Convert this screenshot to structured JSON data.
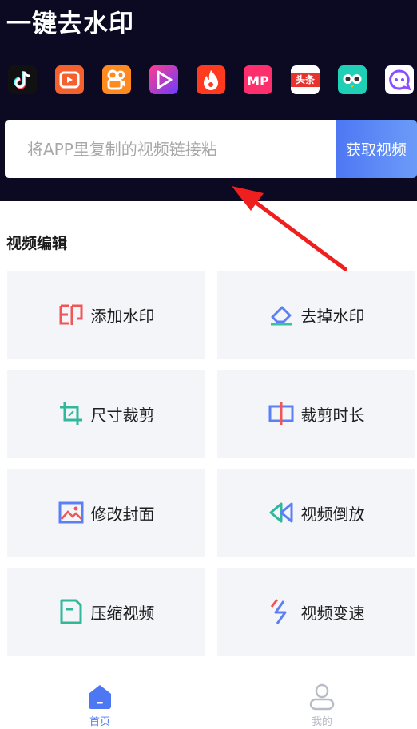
{
  "header": {
    "title": "一键去水印"
  },
  "platforms": [
    {
      "icon": "douyin-icon"
    },
    {
      "icon": "xigua-icon"
    },
    {
      "icon": "kuaishou-icon"
    },
    {
      "icon": "weishi-icon"
    },
    {
      "icon": "huoshan-icon"
    },
    {
      "icon": "meipai-icon"
    },
    {
      "icon": "toutiao-icon",
      "text": "头条"
    },
    {
      "icon": "owl-icon"
    },
    {
      "icon": "chat-icon"
    }
  ],
  "search": {
    "placeholder": "将APP里复制的视频链接粘",
    "button_label": "获取视频"
  },
  "section": {
    "title": "视频编辑"
  },
  "tools": [
    {
      "label": "添加水印",
      "icon": "add-watermark-icon"
    },
    {
      "label": "去掉水印",
      "icon": "eraser-icon"
    },
    {
      "label": "尺寸裁剪",
      "icon": "crop-icon"
    },
    {
      "label": "裁剪时长",
      "icon": "trim-duration-icon"
    },
    {
      "label": "修改封面",
      "icon": "image-icon"
    },
    {
      "label": "视频倒放",
      "icon": "rewind-icon"
    },
    {
      "label": "压缩视频",
      "icon": "compress-file-icon"
    },
    {
      "label": "视频变速",
      "icon": "lightning-icon"
    }
  ],
  "tabbar": {
    "home_label": "首页",
    "mine_label": "我的",
    "active_color": "#4e77f4",
    "inactive_color": "#b8bcc6"
  },
  "colors": {
    "header_bg": "#0b0a22",
    "card_bg": "#f4f5f9",
    "accent": "#4e77f4"
  }
}
